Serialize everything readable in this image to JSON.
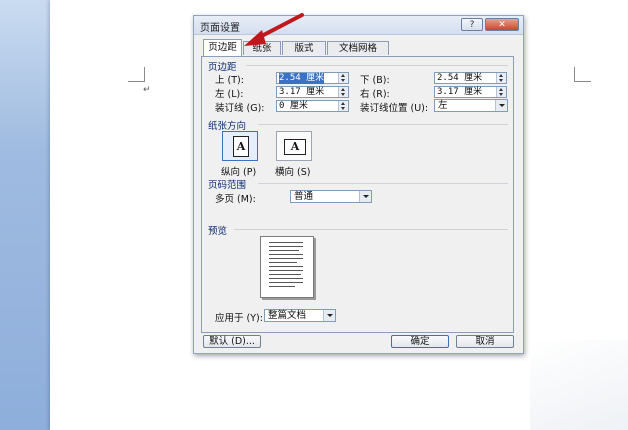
{
  "dialog": {
    "title": "页面设置",
    "help_label": "?",
    "close_label": "✕",
    "tabs": [
      "页边距",
      "纸张",
      "版式",
      "文档网格"
    ],
    "margins_group": "页边距",
    "top_label": "上 (T):",
    "top_value": "2.54 厘米",
    "bottom_label": "下 (B):",
    "bottom_value": "2.54 厘米",
    "left_label": "左 (L):",
    "left_value": "3.17 厘米",
    "right_label": "右 (R):",
    "right_value": "3.17 厘米",
    "gutter_label": "装订线 (G):",
    "gutter_value": "0 厘米",
    "gutter_pos_label": "装订线位置 (U):",
    "gutter_pos_value": "左",
    "orientation_group": "纸张方向",
    "orientation_glyph": "A",
    "portrait_label": "纵向 (P)",
    "landscape_label": "横向 (S)",
    "pages_group": "页码范围",
    "multi_pages_label": "多页 (M):",
    "multi_pages_value": "普通",
    "preview_group": "预览",
    "apply_to_label": "应用于 (Y):",
    "apply_to_value": "整篇文档",
    "default_button": "默认 (D)...",
    "ok_button": "确定",
    "cancel_button": "取消"
  },
  "document": {
    "paragraph_mark": "↵"
  },
  "colors": {
    "annotation_arrow": "#c0181c",
    "selection": "#3a72c7"
  }
}
